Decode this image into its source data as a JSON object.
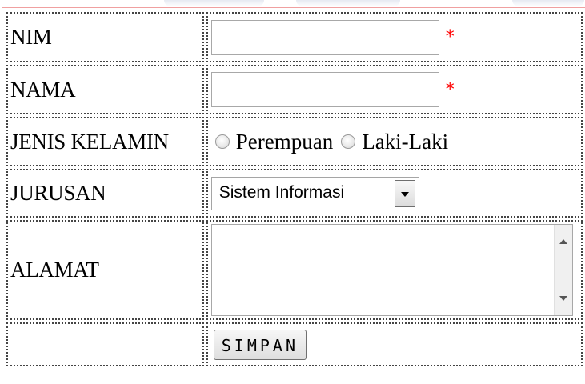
{
  "form": {
    "nim": {
      "label": "NIM",
      "value": "",
      "required_mark": "*"
    },
    "nama": {
      "label": "NAMA",
      "value": "",
      "required_mark": "*"
    },
    "jenis_kelamin": {
      "label": "JENIS KELAMIN",
      "options": [
        "Perempuan",
        "Laki-Laki"
      ],
      "selected": null
    },
    "jurusan": {
      "label": "JURUSAN",
      "selected": "Sistem Informasi"
    },
    "alamat": {
      "label": "ALAMAT",
      "value": ""
    },
    "submit_label": "SIMPAN"
  },
  "colors": {
    "required": "#ff0000",
    "frame_border": "#f0a0a0"
  },
  "icons": [
    "dropdown-arrow-icon",
    "scroll-up-arrow-icon",
    "scroll-down-arrow-icon"
  ]
}
